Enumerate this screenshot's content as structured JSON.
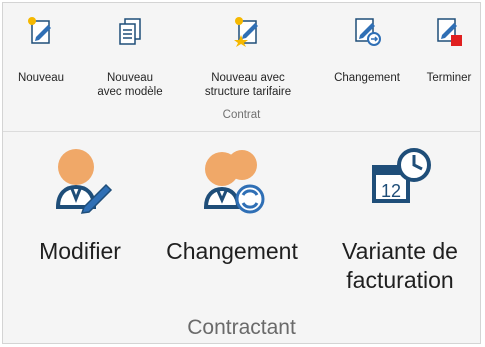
{
  "contrat": {
    "group_label": "Contrat",
    "buttons": [
      {
        "label_line1": "Nouveau",
        "label_line2": "",
        "icon": "new-document-icon"
      },
      {
        "label_line1": "Nouveau",
        "label_line2": "avec modèle",
        "icon": "document-template-icon"
      },
      {
        "label_line1": "Nouveau avec",
        "label_line2": "structure tarifaire",
        "icon": "new-document-star-icon"
      },
      {
        "label_line1": "Changement",
        "label_line2": "",
        "icon": "document-change-icon"
      },
      {
        "label_line1": "Terminer",
        "label_line2": "",
        "icon": "document-terminate-icon"
      }
    ]
  },
  "contractant": {
    "group_label": "Contractant",
    "buttons": [
      {
        "label_line1": "Modifier",
        "label_line2": "",
        "icon": "edit-person-icon"
      },
      {
        "label_line1": "Changement",
        "label_line2": "",
        "icon": "change-person-icon"
      },
      {
        "label_line1": "Variante de",
        "label_line2": "facturation",
        "icon": "billing-calendar-icon"
      }
    ]
  },
  "colors": {
    "person_orange": "#f0a868",
    "icon_blue": "#1f4e79",
    "accent_blue": "#2f6fb5",
    "terminate_red": "#e02020",
    "star_yellow": "#f5b800"
  }
}
